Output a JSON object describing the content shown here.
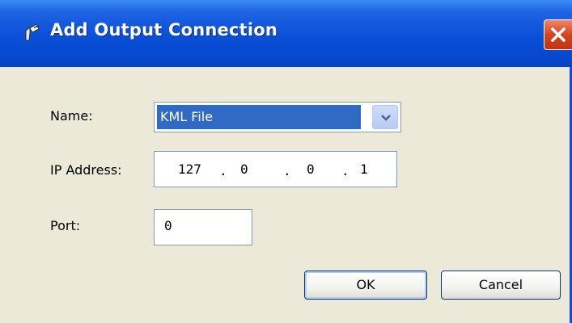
{
  "window": {
    "title": "Add Output Connection",
    "title_icon": "output-connection-icon",
    "close_icon": "close-icon"
  },
  "form": {
    "name_label": "Name:",
    "name_value": "KML File",
    "ip_label": "IP Address:",
    "ip_octets": [
      "127",
      "0",
      "0",
      "1"
    ],
    "ip_separator": ".",
    "port_label": "Port:",
    "port_value": "0"
  },
  "buttons": {
    "ok_label": "OK",
    "cancel_label": "Cancel"
  },
  "colors": {
    "titlebar": "#0a4fd8",
    "dialog_bg": "#ece9d8",
    "selection": "#316ac5",
    "close_button": "#d8421e",
    "field_border": "#7f9db9"
  }
}
